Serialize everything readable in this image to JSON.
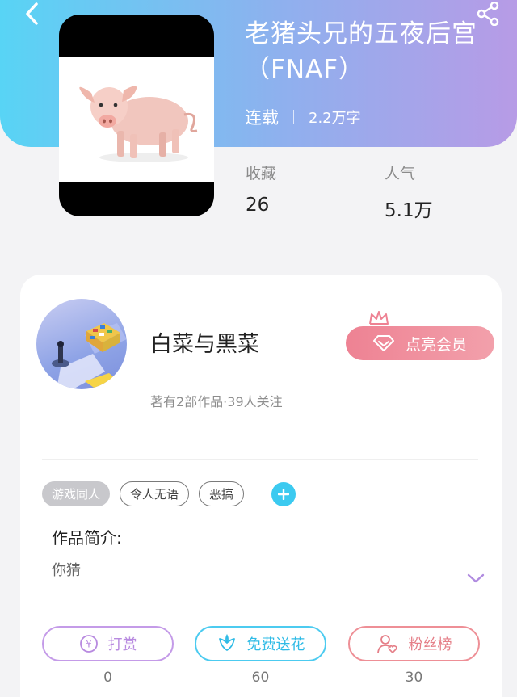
{
  "book": {
    "title": "老猪头兄的五夜后宫（FNAF）",
    "status": "连载",
    "words": "2.2万字"
  },
  "stats": [
    {
      "label": "收藏",
      "value": "26"
    },
    {
      "label": "人气",
      "value": "5.1万"
    }
  ],
  "author": {
    "name": "白菜与黑菜",
    "meta": "著有2部作品·39人关注",
    "vip_label": "点亮会员"
  },
  "tags": [
    "游戏同人",
    "令人无语",
    "恶搞"
  ],
  "intro": {
    "title": "作品简介:",
    "text": "你猜"
  },
  "actions": [
    {
      "label": "打赏",
      "count": "0",
      "color": "#c49be8",
      "icon": "yen-coin-icon"
    },
    {
      "label": "免费送花",
      "count": "60",
      "color": "#4ccbf0",
      "icon": "flower-icon"
    },
    {
      "label": "粉丝榜",
      "count": "30",
      "color": "#ee8f96",
      "icon": "fans-ranking-icon"
    }
  ],
  "colors": {
    "header_gradient_start": "#58d4f5",
    "header_gradient_end": "#b79be6",
    "vip": "#ee8293",
    "accent_blue": "#3ccaf0"
  }
}
